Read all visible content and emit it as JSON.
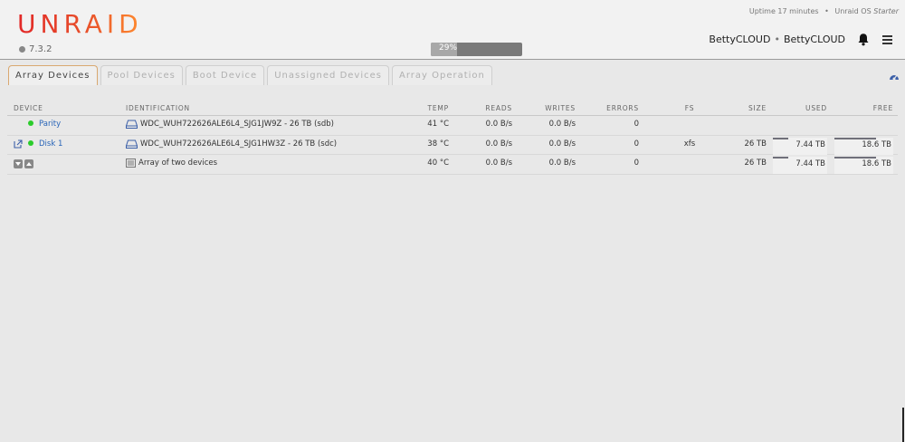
{
  "header": {
    "logo": "UNRAID",
    "version": "7.3.2",
    "progress_label": "29%",
    "progress_fraction": 0.29,
    "uptime": "Uptime 17 minutes",
    "separator": "•",
    "os_label": "Unraid OS",
    "os_edition": "Starter",
    "server_name": "BettyCLOUD",
    "server_description": "BettyCLOUD"
  },
  "tabs": [
    {
      "label": "Array Devices",
      "active": true
    },
    {
      "label": "Pool Devices",
      "active": false
    },
    {
      "label": "Boot Device",
      "active": false
    },
    {
      "label": "Unassigned Devices",
      "active": false
    },
    {
      "label": "Array Operation",
      "active": false
    }
  ],
  "table": {
    "headers": {
      "device": "DEVICE",
      "identification": "IDENTIFICATION",
      "temp": "TEMP",
      "reads": "READS",
      "writes": "WRITES",
      "errors": "ERRORS",
      "fs": "FS",
      "size": "SIZE",
      "used": "USED",
      "free": "FREE"
    },
    "rows": [
      {
        "device": "Parity",
        "identification": "WDC_WUH722626ALE6L4_SJG1JW9Z - 26 TB (sdb)",
        "temp": "41 °C",
        "reads": "0.0 B/s",
        "writes": "0.0 B/s",
        "errors": "0",
        "fs": "",
        "size": "",
        "used": "",
        "free": ""
      },
      {
        "device": "Disk 1",
        "identification": "WDC_WUH722626ALE6L4_SJG1HW3Z - 26 TB (sdc)",
        "temp": "38 °C",
        "reads": "0.0 B/s",
        "writes": "0.0 B/s",
        "errors": "0",
        "fs": "xfs",
        "size": "26 TB",
        "used": "7.44 TB",
        "free": "18.6 TB",
        "used_fraction": 0.29,
        "free_fraction": 0.71
      },
      {
        "device": "",
        "identification": "Array of two devices",
        "temp": "40 °C",
        "reads": "0.0 B/s",
        "writes": "0.0 B/s",
        "errors": "0",
        "fs": "",
        "size": "26 TB",
        "used": "7.44 TB",
        "free": "18.6 TB",
        "used_fraction": 0.29,
        "free_fraction": 0.71
      }
    ]
  }
}
